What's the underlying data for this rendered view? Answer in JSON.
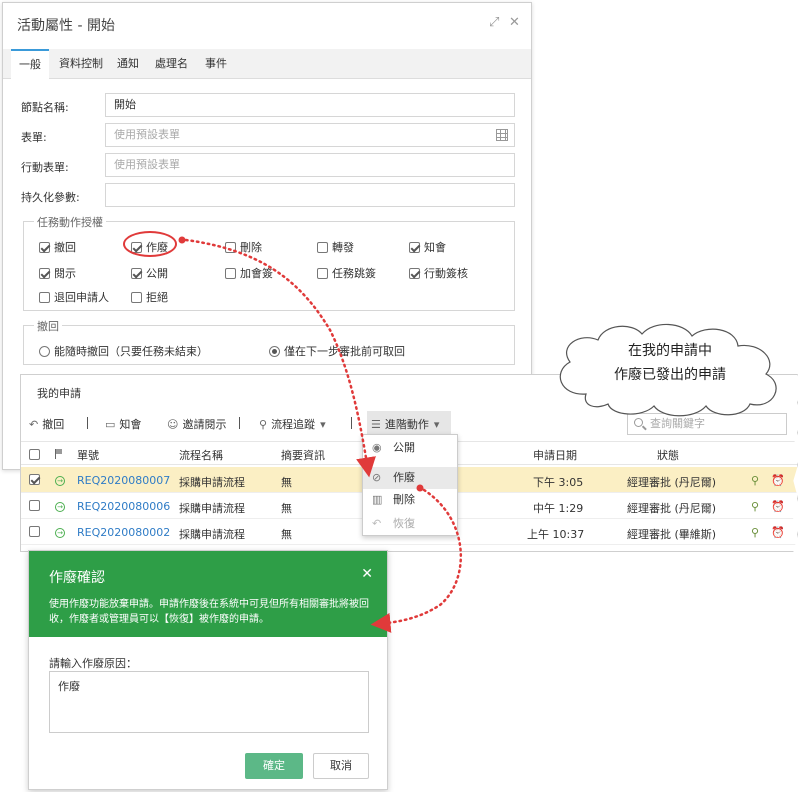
{
  "dialog": {
    "title": "活動屬性 - 開始",
    "tabs": [
      "一般",
      "資料控制",
      "通知",
      "處理名",
      "事件"
    ],
    "fields": {
      "node_name_label": "節點名稱:",
      "node_name_value": "開始",
      "form_label": "表單:",
      "form_placeholder": "使用預設表單",
      "mobile_form_label": "行動表單:",
      "mobile_form_placeholder": "使用預設表單",
      "persist_label": "持久化參數:"
    },
    "permissions": {
      "legend": "任務動作授權",
      "items": [
        {
          "label": "撤回",
          "checked": true
        },
        {
          "label": "作廢",
          "checked": true
        },
        {
          "label": "刪除",
          "checked": false
        },
        {
          "label": "轉發",
          "checked": false
        },
        {
          "label": "知會",
          "checked": true
        },
        {
          "label": "閱示",
          "checked": true
        },
        {
          "label": "公開",
          "checked": true
        },
        {
          "label": "加會簽",
          "checked": false
        },
        {
          "label": "任務跳簽",
          "checked": false
        },
        {
          "label": "行動簽核",
          "checked": true
        },
        {
          "label": "退回申請人",
          "checked": false
        },
        {
          "label": "拒絕",
          "checked": false
        }
      ]
    },
    "withdraw": {
      "legend": "撤回",
      "options": [
        "能隨時撤回（只要任務未結束）",
        "僅在下一步審批前可取回"
      ],
      "selected_index": 1
    }
  },
  "list": {
    "title": "我的申請",
    "toolbar": [
      "撤回",
      "知會",
      "邀請閱示",
      "流程追蹤",
      "進階動作"
    ],
    "search_placeholder": "查詢關鍵字",
    "columns": [
      "單號",
      "流程名稱",
      "摘要資訊",
      "申請日期",
      "狀態"
    ],
    "rows": [
      {
        "id": "REQ2020080007",
        "flow": "採購申請流程",
        "summary": "無",
        "date": "下午 3:05",
        "status": "經理審批 (丹尼爾)",
        "checked": true,
        "selected": true
      },
      {
        "id": "REQ2020080006",
        "flow": "採購申請流程",
        "summary": "無",
        "date": "中午 1:29",
        "status": "經理審批 (丹尼爾)",
        "checked": false,
        "selected": false
      },
      {
        "id": "REQ2020080002",
        "flow": "採購申請流程",
        "summary": "無",
        "date": "上午 10:37",
        "status": "經理審批 (畢維斯)",
        "checked": false,
        "selected": false
      }
    ],
    "menu": [
      {
        "label": "公開",
        "icon": "eye-icon",
        "disabled": false
      },
      {
        "label": "作廢",
        "icon": "ban-icon",
        "disabled": false
      },
      {
        "label": "刪除",
        "icon": "trash-icon",
        "disabled": false
      },
      {
        "label": "恢復",
        "icon": "undo-icon",
        "disabled": true
      }
    ]
  },
  "callout": {
    "line1": "在我的申請中",
    "line2": "作廢已發出的申請"
  },
  "confirm": {
    "title": "作廢確認",
    "description": "使用作廢功能放棄申請。申請作廢後在系統中可見但所有相關審批將被回收，作廢者或管理員可以【恢復】被作廢的申請。",
    "reason_label": "請輸入作廢原因：",
    "reason_value": "作廢",
    "ok_label": "確定",
    "cancel_label": "取消"
  },
  "colors": {
    "accent_green": "#2e9e47",
    "selected_row": "#fbefc4",
    "annotation_red": "#e03a3a",
    "link_blue": "#2f7cc6"
  }
}
